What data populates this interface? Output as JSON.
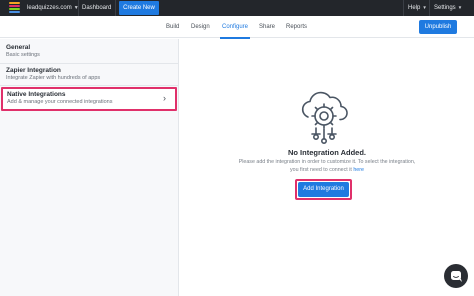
{
  "topbar": {
    "account": "leadquizzes.com",
    "dashboard": "Dashboard",
    "create_new": "Create New",
    "help": "Help",
    "settings": "Settings",
    "logo_colors": [
      "#f5a623",
      "#e0306a",
      "#7ed321",
      "#4a90e2"
    ]
  },
  "tabs": [
    {
      "label": "Build"
    },
    {
      "label": "Design"
    },
    {
      "label": "Configure",
      "active": true
    },
    {
      "label": "Share"
    },
    {
      "label": "Reports"
    }
  ],
  "unpublish": "Unpublish",
  "sidebar": {
    "items": [
      {
        "title": "General",
        "subtitle": "Basic settings"
      },
      {
        "title": "Zapier Integration",
        "subtitle": "Integrate Zapier with hundreds of apps"
      },
      {
        "title": "Native Integrations",
        "subtitle": "Add & manage your connected integrations",
        "active": true
      }
    ]
  },
  "empty_state": {
    "title": "No Integration Added.",
    "line1": "Please add the integration in order to customize it. To select the integration,",
    "line2_prefix": "you first need to connect it ",
    "line2_link": "here",
    "button": "Add Integration"
  },
  "colors": {
    "accent": "#1f7ae0",
    "highlight": "#e0306a",
    "topbar": "#23262b"
  }
}
